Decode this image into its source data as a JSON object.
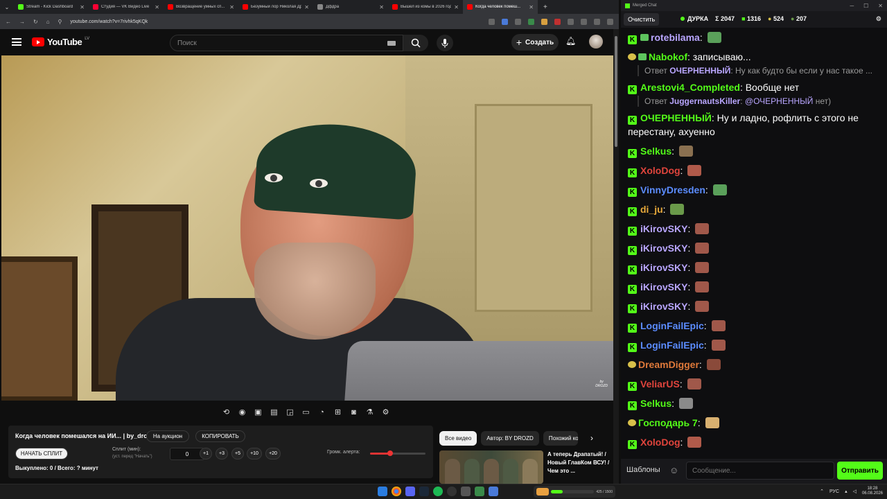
{
  "browser": {
    "tabs": [
      {
        "title": "Stream - Kick Dashboard",
        "color": "#53fc18",
        "active": false
      },
      {
        "title": "Студия — VK Видео Live",
        "color": "#ff0033",
        "active": false
      },
      {
        "title": "Возвращение умных сп...",
        "color": "#ff0000",
        "active": false
      },
      {
        "title": "Безумный лор Николая Др...",
        "color": "#ff0000",
        "active": false
      },
      {
        "title": "Дфдра",
        "color": "#888888",
        "active": false
      },
      {
        "title": "Вышел из комы в 2026 год...",
        "color": "#ff0000",
        "active": false
      },
      {
        "title": "Когда человек помеш...",
        "color": "#ff0000",
        "active": true
      }
    ],
    "new_tab": "+",
    "url": "youtube.com/watch?v=7rivhk5qKQk"
  },
  "youtube": {
    "logo_text": "YouTube",
    "region": "LV",
    "search_placeholder": "Поиск",
    "create_label": "Создать"
  },
  "video": {
    "watermark": "by\nDROZD"
  },
  "panel": {
    "title": "Когда человек помешался на ИИ... | by_drozd",
    "auction_label": "На аукцион",
    "copy_label": "КОПИРОВАТЬ",
    "start_split_label": "НАЧАТЬ СПЛИТ",
    "split_label": "Сплит (мин):",
    "split_hint": "(уст. перед \"Начать\")",
    "split_value": "0",
    "increments": [
      "+1",
      "+3",
      "+5",
      "+10",
      "+20"
    ],
    "volume_label": "Громк. алерта:",
    "volume_level": 0.36,
    "bought": "Выкуплено: 0 / Всего: ? минут"
  },
  "related": {
    "chips": [
      "Все видео",
      "Автор: BY DROZD",
      "Похожий ко"
    ],
    "video_title": "А теперь Драпатый! / Новый ГлавКом ВСУ! / Чем это ..."
  },
  "chat": {
    "window_title": "Merged Chat",
    "clear_label": "Очистить",
    "channel": "ДУРКА",
    "stats": [
      {
        "icon": "sigma",
        "value": "Σ 2047"
      },
      {
        "icon": "kick",
        "value": "1316"
      },
      {
        "icon": "vk",
        "value": "524"
      },
      {
        "icon": "twitch",
        "value": "207"
      }
    ],
    "messages": [
      {
        "platform": "kick",
        "badge": true,
        "user": "rotebilama",
        "color": "#b9a6ff",
        "text": "",
        "emote": "#5aa05a"
      },
      {
        "platform": "vk",
        "badge": true,
        "user": "Nabokof",
        "color": "#53fc18",
        "text": "записываю...",
        "emote": ""
      },
      {
        "reply": true,
        "prefix": "Ответ",
        "user": "ОЧЕРНЕННЫЙ",
        "text": ": Ну как будто бы если у нас такое ..."
      },
      {
        "platform": "kick",
        "badge": false,
        "user": "Arestovi4_Completed",
        "color": "#53fc18",
        "text": "Вообще нет",
        "emote": ""
      },
      {
        "reply": true,
        "prefix": "Ответ",
        "user": "JuggernautsKiller",
        "text": ": ",
        "mention": "@ОЧЕРНЕННЫЙ",
        "tail": " нет)"
      },
      {
        "platform": "kick",
        "badge": false,
        "user": "ОЧЕРНЕННЫЙ",
        "color": "#53fc18",
        "text": "Ну и ладно, рофлить с этого не перестану, ахуенно",
        "emote": ""
      },
      {
        "platform": "kick",
        "badge": false,
        "user": "Selkus",
        "color": "#53fc18",
        "text": "",
        "emote": "#8a7050"
      },
      {
        "platform": "kick",
        "badge": false,
        "user": "XoloDog",
        "color": "#e0443c",
        "text": "",
        "emote": "#b05a4a"
      },
      {
        "platform": "kick",
        "badge": false,
        "user": "VinnyDresden",
        "color": "#5b8cff",
        "text": "",
        "emote": "#5aa05a"
      },
      {
        "platform": "kick",
        "badge": false,
        "user": "di_ju",
        "color": "#e6a83a",
        "text": "",
        "emote": "#6a9a4a"
      },
      {
        "platform": "kick",
        "badge": false,
        "user": "iKirovSKY",
        "color": "#b9a6ff",
        "text": "",
        "emote": "#a0584a"
      },
      {
        "platform": "kick",
        "badge": false,
        "user": "iKirovSKY",
        "color": "#b9a6ff",
        "text": "",
        "emote": "#a0584a"
      },
      {
        "platform": "kick",
        "badge": false,
        "user": "iKirovSKY",
        "color": "#b9a6ff",
        "text": "",
        "emote": "#a0584a"
      },
      {
        "platform": "kick",
        "badge": false,
        "user": "iKirovSKY",
        "color": "#b9a6ff",
        "text": "",
        "emote": "#a0584a"
      },
      {
        "platform": "kick",
        "badge": false,
        "user": "iKirovSKY",
        "color": "#b9a6ff",
        "text": "",
        "emote": "#a0584a"
      },
      {
        "platform": "kick",
        "badge": false,
        "user": "LoginFailEpic",
        "color": "#5b8cff",
        "text": "",
        "emote": "#a0584a"
      },
      {
        "platform": "kick",
        "badge": false,
        "user": "LoginFailEpic",
        "color": "#5b8cff",
        "text": "",
        "emote": "#a0584a"
      },
      {
        "platform": "vk",
        "badge": false,
        "user": "DreamDigger",
        "color": "#e07a3a",
        "text": "",
        "emote": "#8a4a3a"
      },
      {
        "platform": "kick",
        "badge": false,
        "user": "VeliarUS",
        "color": "#e0443c",
        "text": "",
        "emote": "#a0584a"
      },
      {
        "platform": "kick",
        "badge": false,
        "user": "Selkus",
        "color": "#53fc18",
        "text": "",
        "emote": "#8a8a8a"
      },
      {
        "platform": "vk",
        "badge": false,
        "user": "Господарь 7",
        "color": "#53fc18",
        "text": "",
        "emote": "#d8b070"
      },
      {
        "platform": "kick",
        "badge": false,
        "user": "XoloDog",
        "color": "#e0443c",
        "text": "",
        "emote": "#b05a4a"
      }
    ],
    "templates_label": "Шаблоны",
    "input_placeholder": "Сообщение...",
    "send_label": "Отправить"
  },
  "taskbar": {
    "kick_widget": "425 / 1500",
    "kick_progress": 0.28,
    "lang": "РУС",
    "time": "18:28",
    "date": "06.08.2026"
  },
  "colors": {
    "kick": "#53fc18",
    "youtube_red": "#ff0000"
  }
}
